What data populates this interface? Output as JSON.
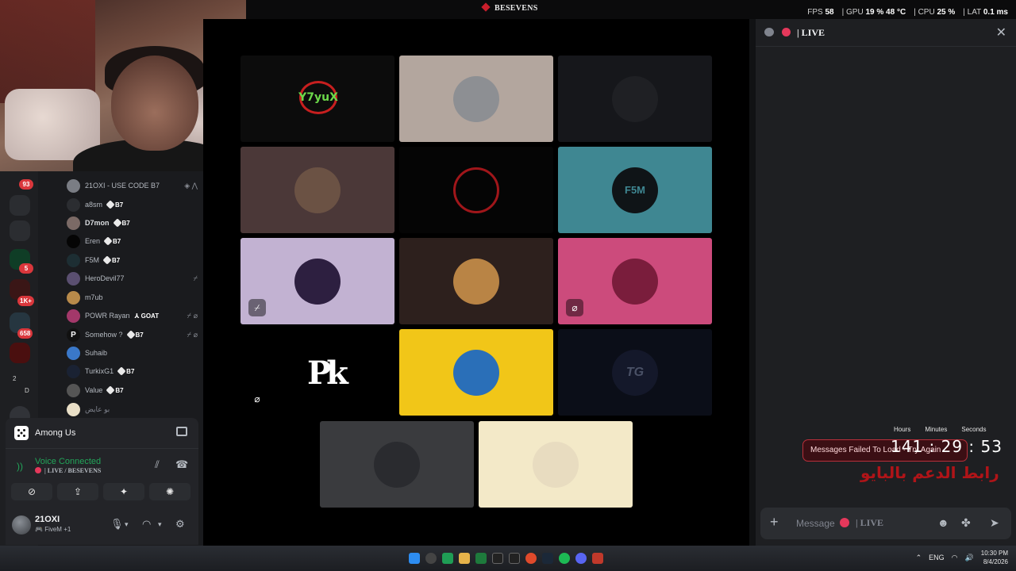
{
  "topbar": {
    "server_name": "BESEVENS",
    "fps_label": "FPS",
    "fps_value": "58",
    "gpu_label": "GPU",
    "gpu_value": "19 % 48 °C",
    "cpu_label": "CPU",
    "cpu_value": "25 %",
    "lat_label": "LAT",
    "lat_value": "0.1 ms"
  },
  "rail": {
    "badges": [
      "93",
      "5",
      "1K+",
      "658"
    ],
    "bottom_text": [
      "2",
      "D"
    ]
  },
  "members": [
    {
      "name": "21OXI - USE CODE B7",
      "tag": "",
      "color": "#8d9199"
    },
    {
      "name": "a8sm",
      "tag": "B7",
      "color": "#b5bac1"
    },
    {
      "name": "D7mon",
      "tag": "B7",
      "color": "#b5bac1"
    },
    {
      "name": "Eren",
      "tag": "B7",
      "color": "#b5bac1"
    },
    {
      "name": "F5M",
      "tag": "B7",
      "color": "#b5bac1"
    },
    {
      "name": "HeroDevil77",
      "tag": "",
      "color": "#b5bac1"
    },
    {
      "name": "m7ub",
      "tag": "",
      "color": "#b5bac1"
    },
    {
      "name": "POWR Rayan",
      "tag": "GOAT",
      "color": "#b5bac1"
    },
    {
      "name": "Somehow ?",
      "tag": "B7",
      "color": "#b5bac1"
    },
    {
      "name": "Suhaib",
      "tag": "",
      "color": "#b5bac1"
    },
    {
      "name": "TurkixG1",
      "tag": "B7",
      "color": "#b5bac1"
    },
    {
      "name": "Value",
      "tag": "B7",
      "color": "#b5bac1"
    },
    {
      "name": "بو عايض",
      "tag": "",
      "color": "#80848e"
    }
  ],
  "activity": {
    "name": "Among Us"
  },
  "voice": {
    "status": "Voice Connected",
    "channel": "| LIVE / BESEVENS"
  },
  "user": {
    "name": "21OXI",
    "status": "FiveM +1"
  },
  "tiles": [
    {
      "bg": "#0c0c0c",
      "type": "y7",
      "label": "Y7yuX"
    },
    {
      "bg": "#b3a69e",
      "type": "avatar",
      "av": "#8d8f93"
    },
    {
      "bg": "#16171b",
      "type": "avatar",
      "av": "#1f2024"
    },
    {
      "bg": "#4b3838",
      "type": "avatar",
      "av": "#6b5244"
    },
    {
      "bg": "#050505",
      "type": "avatar",
      "av": "#0d0d0d"
    },
    {
      "bg": "#3f8792",
      "type": "avatar",
      "av": "#0f1417",
      "label": "F5M"
    },
    {
      "bg": "#c2b2d2",
      "type": "avatar",
      "av": "#2d1f40"
    },
    {
      "bg": "#2d201d",
      "type": "avatar",
      "av": "#b98445"
    },
    {
      "bg": "#cc4b7c",
      "type": "avatar",
      "av": "#7a1d3c"
    },
    {
      "bg": "#000000",
      "type": "pk",
      "label": "Pk"
    },
    {
      "bg": "#f1c618",
      "type": "avatar",
      "av": "#2a6fb8"
    },
    {
      "bg": "#0b0e18",
      "type": "avatar",
      "av": "#14182a",
      "label": "TG"
    },
    {
      "bg": "#3a3b3e",
      "type": "avatar",
      "av": "#2a2b2f"
    },
    {
      "bg": "#f3e9c8",
      "type": "avatar",
      "av": "#e8dcc0"
    }
  ],
  "chat": {
    "title": "| LIVE",
    "timer_labels": [
      "Hours",
      "Minutes",
      "Seconds"
    ],
    "timer": "141 : 29 : 53",
    "error": "Messages Failed To Load · Try Again",
    "arabic": "رابط الدعم بالبايو",
    "placeholder_prefix": "Message",
    "placeholder_channel": "| LIVE"
  },
  "taskbar": {
    "lang": "ENG",
    "time": "10:30 PM",
    "date": "8/4/2026"
  }
}
